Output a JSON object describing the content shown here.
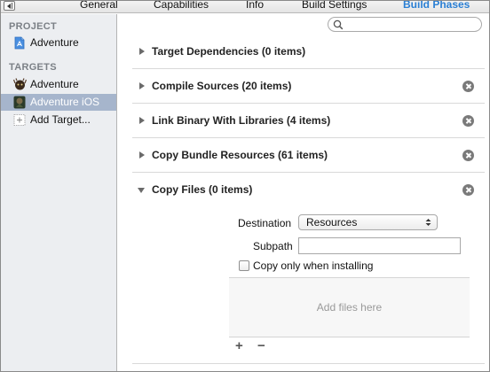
{
  "tabs": [
    {
      "label": "General"
    },
    {
      "label": "Capabilities"
    },
    {
      "label": "Info"
    },
    {
      "label": "Build Settings"
    },
    {
      "label": "Build Phases",
      "active": true
    }
  ],
  "sidebar": {
    "project_heading": "PROJECT",
    "project_items": [
      {
        "label": "Adventure",
        "icon": "project-file-icon"
      }
    ],
    "targets_heading": "TARGETS",
    "target_items": [
      {
        "label": "Adventure",
        "icon": "app-target-icon"
      },
      {
        "label": "Adventure iOS",
        "icon": "ios-app-target-icon",
        "selected": true
      },
      {
        "label": "Add Target...",
        "icon": "add-target-icon"
      }
    ]
  },
  "search": {
    "placeholder": ""
  },
  "phases": [
    {
      "title": "Target Dependencies (0 items)",
      "expanded": false,
      "deletable": false
    },
    {
      "title": "Compile Sources (20 items)",
      "expanded": false,
      "deletable": true
    },
    {
      "title": "Link Binary With Libraries (4 items)",
      "expanded": false,
      "deletable": true
    },
    {
      "title": "Copy Bundle Resources (61 items)",
      "expanded": false,
      "deletable": true
    },
    {
      "title": "Copy Files (0 items)",
      "expanded": true,
      "deletable": true
    }
  ],
  "copy_files": {
    "destination_label": "Destination",
    "destination_value": "Resources",
    "subpath_label": "Subpath",
    "subpath_value": "",
    "checkbox_label": "Copy only when installing",
    "checkbox_checked": false,
    "drop_hint": "Add files here",
    "add_label": "+",
    "remove_label": "−"
  },
  "colors": {
    "accent": "#2a7fd4",
    "sidebar_bg": "#eceef1",
    "selection": "#a6b5cc"
  }
}
